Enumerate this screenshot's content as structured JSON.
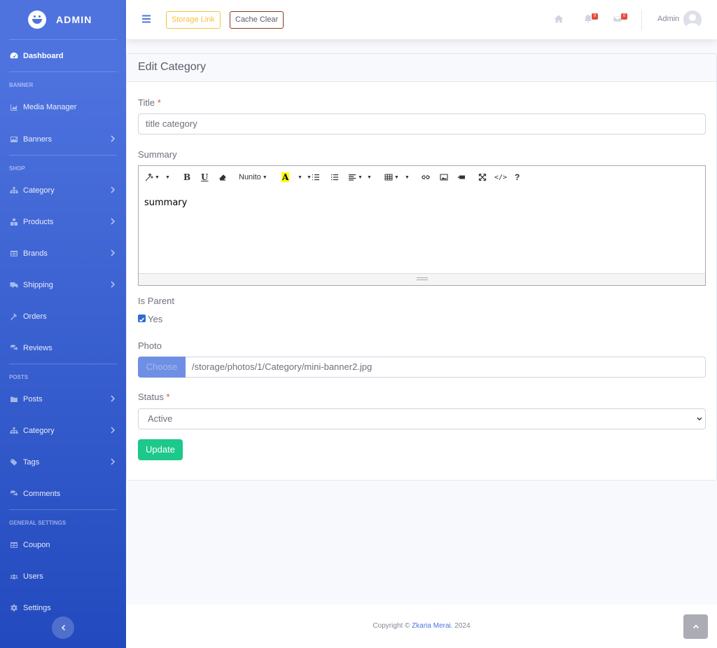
{
  "brand": {
    "name": "ADMIN"
  },
  "sidebar": {
    "dashboard": "Dashboard",
    "heading_banner": "BANNER",
    "media_manager": "Media Manager",
    "banners": "Banners",
    "heading_shop": "SHOP",
    "category": "Category",
    "products": "Products",
    "brands": "Brands",
    "shipping": "Shipping",
    "orders": "Orders",
    "reviews": "Reviews",
    "heading_posts": "POSTS",
    "posts": "Posts",
    "post_category": "Category",
    "tags": "Tags",
    "comments": "Comments",
    "heading_general": "GENERAL SETTINGS",
    "coupon": "Coupon",
    "users": "Users",
    "settings": "Settings"
  },
  "topbar": {
    "storage_link": "Storage Link",
    "cache_clear": "Cache Clear",
    "alerts_count": "0",
    "messages_count": "0",
    "user_name": "Admin"
  },
  "form": {
    "card_title": "Edit Category",
    "title_label": "Title",
    "required_mark": "*",
    "title_value": "title category",
    "summary_label": "Summary",
    "editor_font": "Nunito",
    "summary_content": "summary",
    "is_parent_label": "Is Parent",
    "is_parent_option": "Yes",
    "is_parent_checked": true,
    "photo_label": "Photo",
    "choose_label": "Choose",
    "photo_value": "/storage/photos/1/Category/mini-banner2.jpg",
    "status_label": "Status",
    "status_value": "Active",
    "update_label": "Update"
  },
  "footer": {
    "copyright_prefix": "Copyright ©",
    "author": "Zkaria Merai",
    "year": ". 2024"
  },
  "colors": {
    "primary": "#4e73df",
    "success": "#1cc88a",
    "danger": "#e74a3b",
    "warning": "#f6c23e"
  }
}
